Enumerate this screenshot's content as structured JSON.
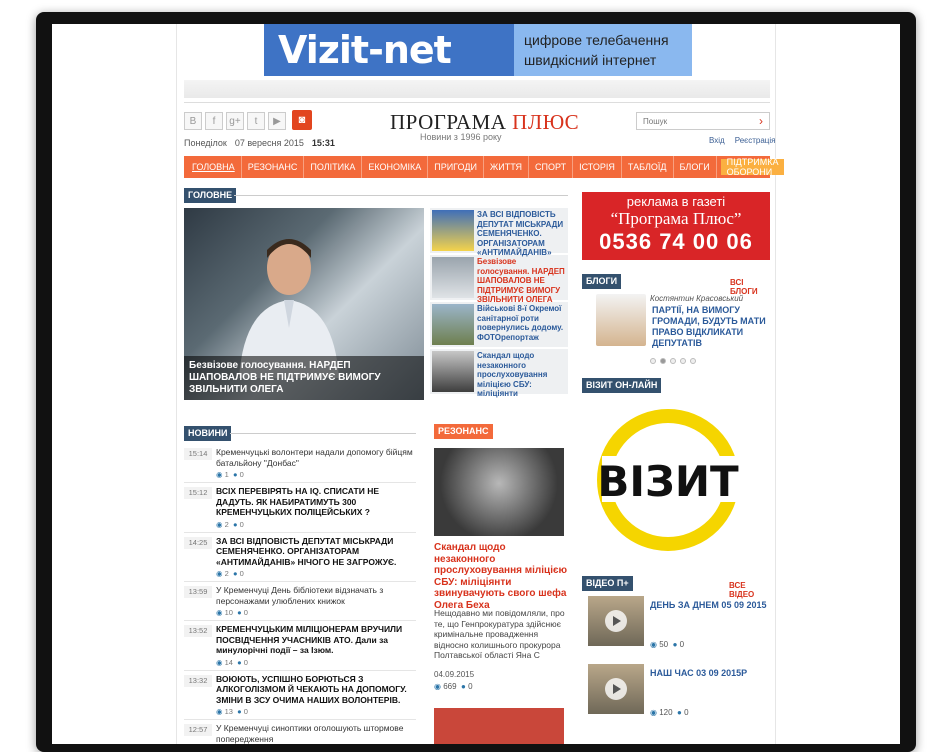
{
  "banner": {
    "logo": "Vizit-net",
    "line1": "цифрове телебачення",
    "line2": "швидкісний інтернет"
  },
  "header": {
    "site_title": "ПРОГРАМА",
    "site_title_plus": "ПЛЮС",
    "subtitle": "Новини з 1996 року",
    "day": "Понеділок",
    "date": "07 вересня 2015",
    "time": "15:31",
    "search_placeholder": "Пошук",
    "login": "Вхід",
    "register": "Реєстрація",
    "social": [
      "В",
      "f",
      "g+",
      "t",
      "▶"
    ]
  },
  "nav": [
    "ГОЛОВНА",
    "РЕЗОНАНС",
    "ПОЛІТИКА",
    "ЕКОНОМІКА",
    "ПРИГОДИ",
    "ЖИТТЯ",
    "СПОРТ",
    "ІСТОРІЯ",
    "ТАБЛОЇД",
    "БЛОГИ",
    "ПІДТРИМКА ОБОРОНИ"
  ],
  "sections": {
    "main": "ГОЛОВНЕ",
    "news": "НОВИНИ",
    "resonance": "РЕЗОНАНС",
    "blogs": "БЛОГИ",
    "all_blogs": "ВСІ БЛОГИ",
    "vizit": "ВІЗИТ ОН-ЛАЙН",
    "video": "ВІДЕО П+",
    "all_video": "ВСЕ ВІДЕО"
  },
  "hero": {
    "caption": "Безвізове голосування. НАРДЕП ШАПОВАЛОВ НЕ ПІДТРИМУЄ ВИМОГУ ЗВІЛЬНИТИ ОЛЕГА"
  },
  "side_stories": [
    {
      "title": "ЗА ВСІ ВІДПОВІСТЬ ДЕПУТАТ МІСЬКРАДИ СЕМЕНЯЧЕНКО. ОРГАНІЗАТОРАМ «АНТИМАЙДАНІВ»",
      "red": false
    },
    {
      "title": "Безвізове голосування. НАРДЕП ШАПОВАЛОВ НЕ ПІДТРИМУЄ ВИМОГУ ЗВІЛЬНИТИ ОЛЕГА",
      "red": true
    },
    {
      "title": "Військові 8-ї Окремої санітарної роти повернулись додому. ФОТОрепортаж",
      "red": false
    },
    {
      "title": "Скандал щодо незаконного прослуховування міліцією СБУ: міліціянти",
      "red": false
    }
  ],
  "ad": {
    "l1": "реклама в газеті",
    "l2": "“Програма Плюс”",
    "l3": "0536 74 00 06"
  },
  "blog": {
    "author": "Костянтин Красовський",
    "title": "ПАРТІЇ, НА ВИМОГУ ГРОМАДИ, БУДУТЬ МАТИ ПРАВО ВІДКЛИКАТИ ДЕПУТАТІВ"
  },
  "vizit_logo": "ВІЗИТ",
  "videos": [
    {
      "title": "ДЕНЬ ЗА ДНЕМ 05 09 2015",
      "views": "50",
      "comments": "0"
    },
    {
      "title": "НАШ ЧАС 03 09 2015Р",
      "views": "120",
      "comments": "0"
    }
  ],
  "news": [
    {
      "time": "15:14",
      "title": "Кременчуцькі волонтери надали допомогу бійцям батальйону \"Донбас\"",
      "bold": false,
      "views": "1",
      "comments": "0"
    },
    {
      "time": "15:12",
      "title": "ВСІХ ПЕРЕВІРЯТЬ НА IQ. СПИСАТИ НЕ ДАДУТЬ. ЯК НАБИРАТИМУТЬ 300 КРЕМЕНЧУЦЬКИХ ПОЛІЦЕЙСЬКИХ ?",
      "bold": true,
      "views": "2",
      "comments": "0"
    },
    {
      "time": "14:25",
      "title": "ЗА ВСІ ВІДПОВІСТЬ ДЕПУТАТ МІСЬКРАДИ СЕМЕНЯЧЕНКО. ОРГАНІЗАТОРАМ «АНТИМАЙДАНІВ» НІЧОГО НЕ ЗАГРОЖУЄ.",
      "bold": true,
      "views": "2",
      "comments": "0"
    },
    {
      "time": "13:59",
      "title": "У Кременчуці День бібліотеки відзначать з персонажами улюблених книжок",
      "bold": false,
      "views": "10",
      "comments": "0"
    },
    {
      "time": "13:52",
      "title": "КРЕМЕНЧУЦЬКИМ МІЛІЦІОНЕРАМ ВРУЧИЛИ ПОСВІДЧЕННЯ УЧАСНИКІВ АТО. Дали за минулорічні події – за Ізюм.",
      "bold": true,
      "views": "14",
      "comments": "0"
    },
    {
      "time": "13:32",
      "title": "ВОЮЮТЬ, УСПІШНО БОРЮТЬСЯ З АЛКОГОЛІЗМОМ Й ЧЕКАЮТЬ НА ДОПОМОГУ. ЗМІНИ В ЗСУ ОЧИМА НАШИХ ВОЛОНТЕРІВ.",
      "bold": true,
      "views": "13",
      "comments": "0"
    },
    {
      "time": "12:57",
      "title": "У Кременчуці синоптики оголошують штормове попередження",
      "bold": false,
      "views": "",
      "comments": ""
    }
  ],
  "resonance": {
    "title": "Скандал щодо незаконного прослуховування міліцією СБУ: міліціянти звинувачують свого шефа Олега Беха",
    "text": "Нещодавно ми повідомляли, про те, що Генпрокуратура здійснює кримінальне провадження відносно колишнього прокурора Полтавської області Яна С",
    "date": "04.09.2015",
    "views": "669",
    "comments": "0"
  }
}
